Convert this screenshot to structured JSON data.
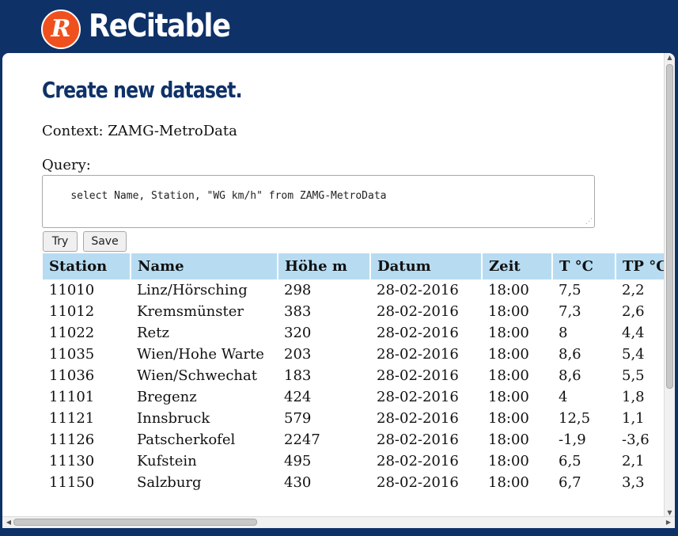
{
  "app": {
    "logo_letter": "R",
    "name": "ReCitable"
  },
  "page": {
    "title": "Create new dataset.",
    "context": "Context: ZAMG-MetroData",
    "query_label": "Query:",
    "query_value": "select Name, Station, \"WG km/h\" from ZAMG-MetroData"
  },
  "buttons": {
    "try": "Try",
    "save": "Save"
  },
  "table": {
    "headers": [
      "Station",
      "Name",
      "Höhe m",
      "Datum",
      "Zeit",
      "T °C",
      "TP °C"
    ],
    "rows": [
      [
        "11010",
        "Linz/Hörsching",
        "298",
        "28-02-2016",
        "18:00",
        "7,5",
        "2,2"
      ],
      [
        "11012",
        "Kremsmünster",
        "383",
        "28-02-2016",
        "18:00",
        "7,3",
        "2,6"
      ],
      [
        "11022",
        "Retz",
        "320",
        "28-02-2016",
        "18:00",
        "8",
        "4,4"
      ],
      [
        "11035",
        "Wien/Hohe Warte",
        "203",
        "28-02-2016",
        "18:00",
        "8,6",
        "5,4"
      ],
      [
        "11036",
        "Wien/Schwechat",
        "183",
        "28-02-2016",
        "18:00",
        "8,6",
        "5,5"
      ],
      [
        "11101",
        "Bregenz",
        "424",
        "28-02-2016",
        "18:00",
        "4",
        "1,8"
      ],
      [
        "11121",
        "Innsbruck",
        "579",
        "28-02-2016",
        "18:00",
        "12,5",
        "1,1"
      ],
      [
        "11126",
        "Patscherkofel",
        "2247",
        "28-02-2016",
        "18:00",
        "-1,9",
        "-3,6"
      ],
      [
        "11130",
        "Kufstein",
        "495",
        "28-02-2016",
        "18:00",
        "6,5",
        "2,1"
      ],
      [
        "11150",
        "Salzburg",
        "430",
        "28-02-2016",
        "18:00",
        "6,7",
        "3,3"
      ]
    ]
  },
  "colors": {
    "brand_navy": "#0e3168",
    "logo_orange": "#f0501e",
    "table_header": "#b7dcf2"
  }
}
